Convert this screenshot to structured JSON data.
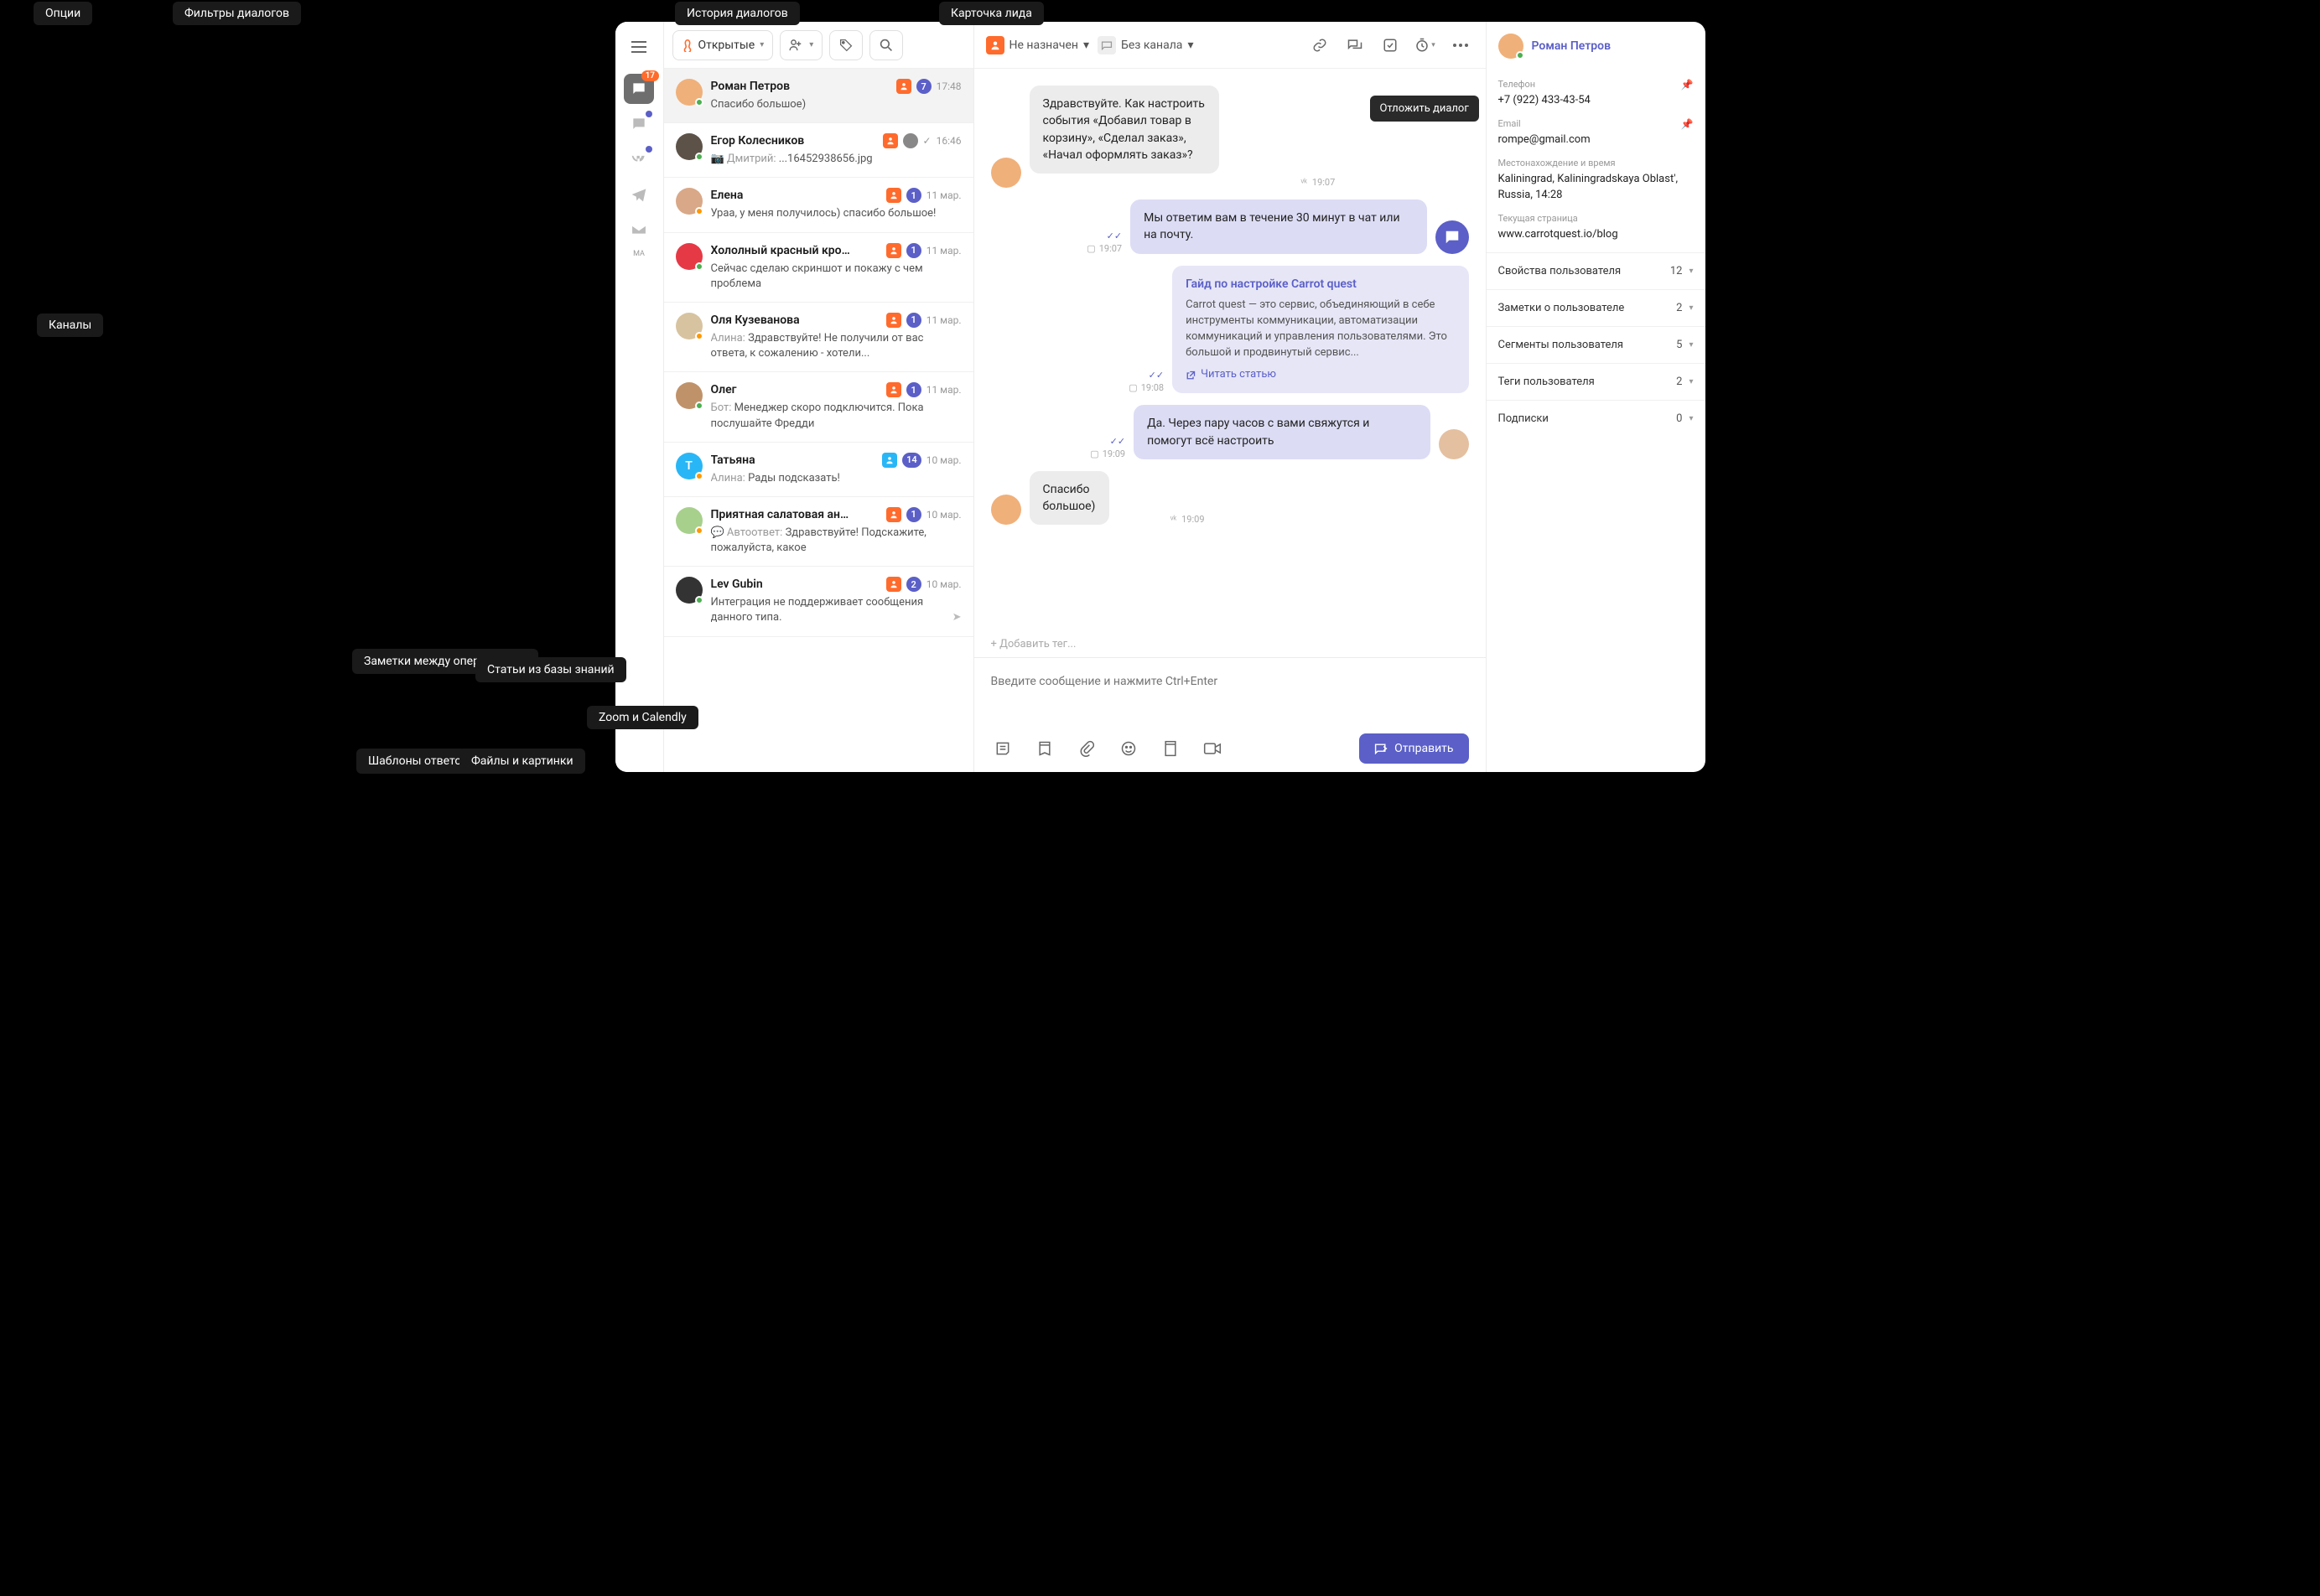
{
  "callouts": {
    "options": "Опции",
    "dialog_filters": "Фильтры диалогов",
    "dialog_history": "История диалогов",
    "lead_card": "Карточка лида",
    "channels": "Каналы",
    "postpone": "Отложить диалог",
    "notes": "Заметки между операторами",
    "kb": "Статьи из базы знаний",
    "zoom": "Zoom и Calendly",
    "templates": "Шаблоны ответов",
    "files": "Файлы и картинки"
  },
  "rail": {
    "badge": "17",
    "ma_label": "MA"
  },
  "toolbar": {
    "open_filter": "Открытые"
  },
  "dialogs": [
    {
      "name": "Роман Петров",
      "preview": "Спасибо большое)",
      "count": "7",
      "time": "17:48",
      "color": "#f0b07a",
      "presence": "dot-green",
      "selected": true
    },
    {
      "name": "Егор Колесников",
      "prefix": "📷 Дмитрий: ",
      "preview": "...16452938656.jpg",
      "count": "",
      "time": "16:46",
      "check": true,
      "color": "#5c5248",
      "presence": "dot-green",
      "mini": true
    },
    {
      "name": "Елена",
      "preview": "Ураа, у меня получилось) спасибо большое!",
      "count": "1",
      "time": "11 мар.",
      "color": "#d8a888",
      "presence": "dot-orange"
    },
    {
      "name": "Хололный красный кро…",
      "preview": "Сейчас сделаю скриншот и покажу с чем проблема",
      "count": "1",
      "time": "11 мар.",
      "color": "#e63946",
      "presence": "dot-green"
    },
    {
      "name": "Оля Кузеванова",
      "prefix": "Алина: ",
      "preview": "Здравствуйте! Не получили от вас ответа, к сожалению - хотели...",
      "count": "1",
      "time": "11 мар.",
      "color": "#d8c3a0",
      "presence": "dot-orange"
    },
    {
      "name": "Олег",
      "prefix": "Бот: ",
      "preview": "Менеджер скоро подключится. Пока послушайте Фредди",
      "count": "1",
      "time": "11 мар.",
      "color": "#c0926a",
      "presence": "dot-green"
    },
    {
      "name": "Татьяна",
      "prefix": "Алина: ",
      "preview": "Рады подсказать!",
      "count": "14",
      "time": "10 мар.",
      "color": "#29b6f6",
      "letter": "T",
      "presence": "dot-orange",
      "tel": true
    },
    {
      "name": "Приятная салатовая ан…",
      "prefix": "💬 Автоответ: ",
      "preview": "Здравствуйте! Подскажите, пожалуйста, какое",
      "count": "1",
      "time": "10 мар.",
      "color": "#a8d08d",
      "presence": "dot-orange"
    },
    {
      "name": "Lev Gubin",
      "preview": "Интеграция не поддерживает сообщения данного типа.",
      "count": "2",
      "time": "10 мар.",
      "color": "#333",
      "presence": "dot-green",
      "send": true
    }
  ],
  "chat_toolbar": {
    "unassigned": "Не назначен",
    "no_channel": "Без канала"
  },
  "messages": {
    "incoming1": "Здравствуйте. Как настроить события «Добавил товар в корзину», «Сделал заказ», «Начал оформлять заказ»?",
    "incoming1_time": "19:07",
    "auto": "Мы ответим вам в течение 30 минут в чат или на почту.",
    "auto_time": "19:07",
    "card_title": "Гайд по настройке Carrot quest",
    "card_text": "Carrot quest — это сервис, объединяющий в себе инструменты коммуникации, автоматизации коммуникаций и управления пользователями. Это большой и продвинутый сервис...",
    "card_link": "Читать статью",
    "card_time": "19:08",
    "reply": "Да. Через пару часов с вами свяжутся и помогут всё настроить",
    "reply_time": "19:09",
    "incoming2": "Спасибо большое)",
    "incoming2_time": "19:09"
  },
  "tags": {
    "add": "+ Добавить тег..."
  },
  "composer": {
    "placeholder": "Введите сообщение и нажмите Ctrl+Enter",
    "send": "Отправить"
  },
  "lead": {
    "name": "Роман Петров",
    "phone_label": "Телефон",
    "phone": "+7 (922) 433-43-54",
    "email_label": "Email",
    "email": "rompe@gmail.com",
    "loc_label": "Местонахождение и время",
    "loc": "Kaliningrad, Kaliningradskaya Oblast', Russia, 14:28",
    "page_label": "Текущая страница",
    "page": "www.carrotquest.io/blog",
    "acc": [
      {
        "label": "Свойства пользователя",
        "count": "12"
      },
      {
        "label": "Заметки о пользователе",
        "count": "2"
      },
      {
        "label": "Сегменты пользователя",
        "count": "5"
      },
      {
        "label": "Теги пользователя",
        "count": "2"
      },
      {
        "label": "Подписки",
        "count": "0"
      }
    ]
  }
}
